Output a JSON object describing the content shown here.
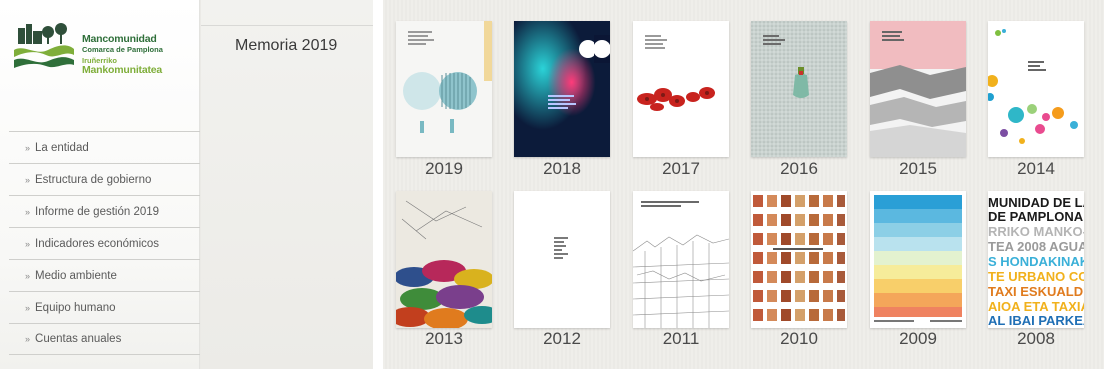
{
  "logo": {
    "line1": "Mancomunidad",
    "line2": "Comarca de Pamplona",
    "line3": "Iruñerriko",
    "line4": "Mankomunitatea"
  },
  "nav": {
    "items": [
      {
        "label": "La entidad"
      },
      {
        "label": "Estructura de gobierno"
      },
      {
        "label": "Informe de gestión 2019"
      },
      {
        "label": "Indicadores económicos"
      },
      {
        "label": "Medio ambiente"
      },
      {
        "label": "Equipo humano"
      },
      {
        "label": "Cuentas anuales"
      }
    ]
  },
  "page": {
    "title": "Memoria 2019"
  },
  "reports": [
    {
      "year": "2019"
    },
    {
      "year": "2018"
    },
    {
      "year": "2017"
    },
    {
      "year": "2016"
    },
    {
      "year": "2015"
    },
    {
      "year": "2014"
    },
    {
      "year": "2013"
    },
    {
      "year": "2012"
    },
    {
      "year": "2011"
    },
    {
      "year": "2010"
    },
    {
      "year": "2009"
    },
    {
      "year": "2008"
    }
  ],
  "cover_2008_text": [
    "MUNIDAD DE LA",
    "DE PAMPLONA",
    "RRIKO MANKO-",
    "TEA 2008 AGUA",
    "S HONDAKINAK",
    "TE URBANO CO-",
    "TAXI ESKUALDE-",
    "AIOA ETA TAXIA",
    "AL IBAI PARKEA"
  ],
  "colors": {
    "brand_green": "#2f6f3a",
    "brand_lime": "#7fae3a",
    "text_gray": "#5a5a5a"
  }
}
